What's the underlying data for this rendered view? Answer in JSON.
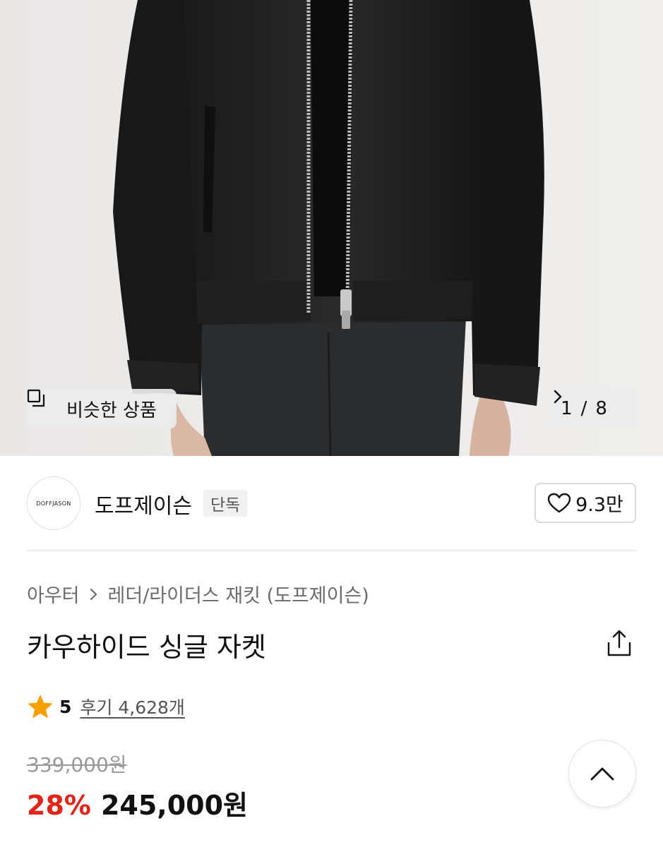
{
  "gallery": {
    "image_alt_icon": "leather-jacket-photo",
    "similar_label": "비슷한 상품",
    "page_current": "1",
    "page_total": "8",
    "page_separator": "/"
  },
  "brand": {
    "logo_text": "DOFFJASON",
    "name": "도프제이슨",
    "badge": "단독",
    "likes": "9.3만"
  },
  "breadcrumb": {
    "category": "아우터",
    "subcategory": "레더/라이더스 재킷 (도프제이슨)"
  },
  "product": {
    "title": "카우하이드 싱글 자켓",
    "rating": "5",
    "reviews_label": "후기 4,628개",
    "original_price": "339,000원",
    "discount": "28%",
    "sale_price": "245,000원"
  },
  "colors": {
    "discount_red": "#e2231a",
    "star_orange": "#f6a000",
    "background": "#ffffff"
  }
}
